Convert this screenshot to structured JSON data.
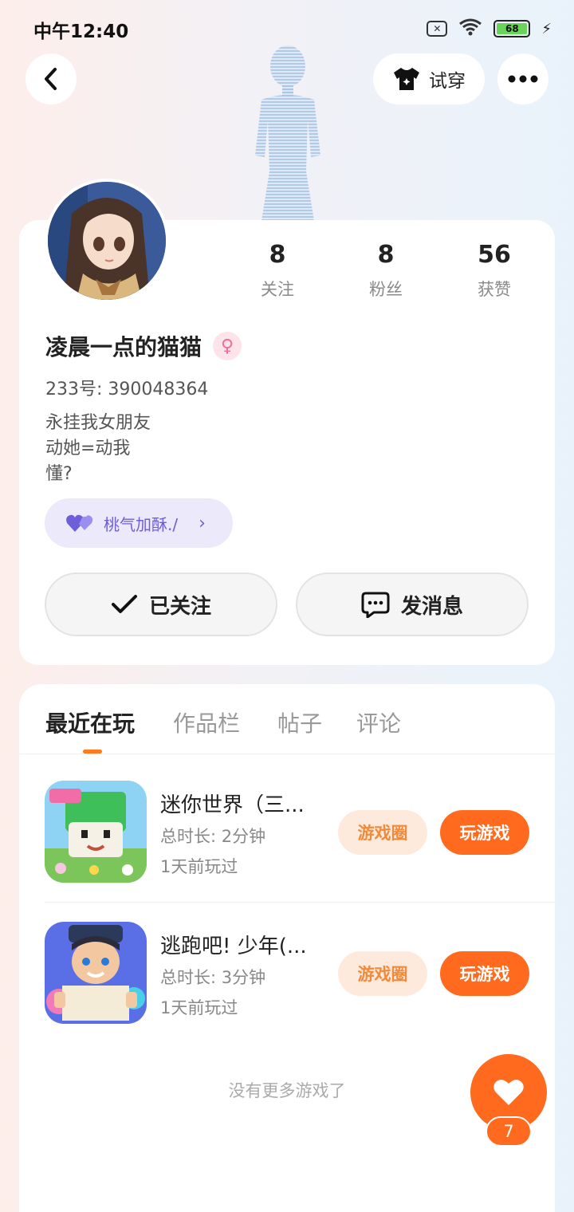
{
  "status": {
    "time": "中午12:40",
    "battery": "68"
  },
  "header": {
    "tryon_label": "试穿"
  },
  "profile": {
    "stats": [
      {
        "value": "8",
        "label": "关注"
      },
      {
        "value": "8",
        "label": "粉丝"
      },
      {
        "value": "56",
        "label": "获赞"
      }
    ],
    "name": "凌晨一点的猫猫",
    "uid": "233号: 390048364",
    "bio": [
      "永挂我女朋友",
      "动她=动我",
      "懂?"
    ],
    "tag_label": "桃气加酥./",
    "follow_label": "已关注",
    "message_label": "发消息"
  },
  "tabs": [
    {
      "label": "最近在玩",
      "active": true
    },
    {
      "label": "作品栏",
      "active": false
    },
    {
      "label": "帖子",
      "active": false
    },
    {
      "label": "评论",
      "active": false
    }
  ],
  "games": [
    {
      "name": "迷你世界（三...",
      "duration": "总时长: 2分钟",
      "last_played": "1天前玩过",
      "circle_label": "游戏圈",
      "play_label": "玩游戏"
    },
    {
      "name": "逃跑吧! 少年(...",
      "duration": "总时长: 3分钟",
      "last_played": "1天前玩过",
      "circle_label": "游戏圈",
      "play_label": "玩游戏"
    }
  ],
  "footer": {
    "no_more": "没有更多游戏了",
    "like_count": "7"
  },
  "colors": {
    "accent": "#ff6a1e",
    "tag": "#6e5fd8",
    "female": "#f06c9b"
  }
}
